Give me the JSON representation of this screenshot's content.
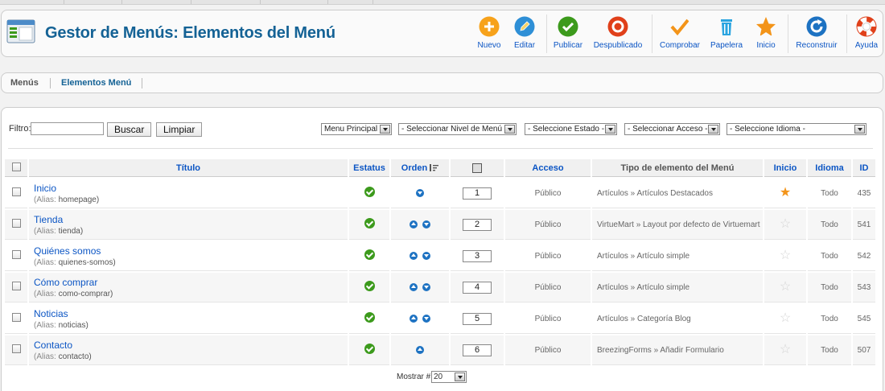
{
  "header": {
    "title": "Gestor de Menús: Elementos del Menú",
    "page_icon": "menu-manager-icon"
  },
  "toolbar": {
    "buttons": [
      {
        "label": "Nuevo",
        "icon": "plus-circle-icon",
        "color": "#f7a21b"
      },
      {
        "label": "Editar",
        "icon": "pencil-icon",
        "color": "#2e8fd6"
      },
      {
        "label": "Publicar",
        "icon": "check-circle-icon",
        "color": "#3c9a1c"
      },
      {
        "label": "Despublicado",
        "icon": "unpublish-circle-icon",
        "color": "#e0401a"
      },
      {
        "label": "Comprobar",
        "icon": "checkmark-icon",
        "color": "#f39419"
      },
      {
        "label": "Papelera",
        "icon": "trash-icon",
        "color": "#2aa4e0"
      },
      {
        "label": "Inicio",
        "icon": "star-icon",
        "color": "#f39419"
      },
      {
        "label": "Reconstruir",
        "icon": "refresh-icon",
        "color": "#1d72c2"
      },
      {
        "label": "Ayuda",
        "icon": "lifebuoy-icon",
        "color": "#e0401a"
      }
    ]
  },
  "submenu": {
    "items": [
      {
        "label": "Menús",
        "active": false
      },
      {
        "label": "Elementos Menú",
        "active": true
      }
    ]
  },
  "filter": {
    "label": "Filtro:",
    "value": "",
    "search_label": "Buscar",
    "clear_label": "Limpiar",
    "selects": [
      "Menu Principal",
      "- Seleccionar Nivel de Menú -",
      "- Seleccione Estado -",
      "- Seleccionar Acceso -",
      "- Seleccione Idioma -"
    ]
  },
  "table": {
    "columns": {
      "title": "Título",
      "status": "Estatus",
      "order": "Orden",
      "access": "Acceso",
      "type": "Tipo de elemento del Menú",
      "home": "Inicio",
      "language": "Idioma",
      "id": "ID"
    },
    "alias_label": "(Alias:",
    "rows": [
      {
        "title": "Inicio",
        "alias": "homepage)",
        "order": "1",
        "access": "Público",
        "type": "Artículos » Artículos Destacados",
        "home": true,
        "language": "Todo",
        "id": "435",
        "up": false,
        "down": true
      },
      {
        "title": "Tienda",
        "alias": "tienda)",
        "order": "2",
        "access": "Público",
        "type": "VirtueMart » Layout por defecto de Virtuemart",
        "home": false,
        "language": "Todo",
        "id": "541",
        "up": true,
        "down": true
      },
      {
        "title": "Quiénes somos",
        "alias": "quienes-somos)",
        "order": "3",
        "access": "Público",
        "type": "Artículos » Artículo simple",
        "home": false,
        "language": "Todo",
        "id": "542",
        "up": true,
        "down": true
      },
      {
        "title": "Cómo comprar",
        "alias": "como-comprar)",
        "order": "4",
        "access": "Público",
        "type": "Artículos » Artículo simple",
        "home": false,
        "language": "Todo",
        "id": "543",
        "up": true,
        "down": true
      },
      {
        "title": "Noticias",
        "alias": "noticias)",
        "order": "5",
        "access": "Público",
        "type": "Artículos » Categoría Blog",
        "home": false,
        "language": "Todo",
        "id": "545",
        "up": true,
        "down": true
      },
      {
        "title": "Contacto",
        "alias": "contacto)",
        "order": "6",
        "access": "Público",
        "type": "BreezingForms » Añadir Formulario",
        "home": false,
        "language": "Todo",
        "id": "507",
        "up": true,
        "down": false
      }
    ]
  },
  "pagination": {
    "label": "Mostrar #",
    "value": "20"
  },
  "colors": {
    "title_blue": "#146295",
    "link_blue": "#0b55c4",
    "publish_green": "#3c9a1c",
    "home_star": "#f39419"
  }
}
